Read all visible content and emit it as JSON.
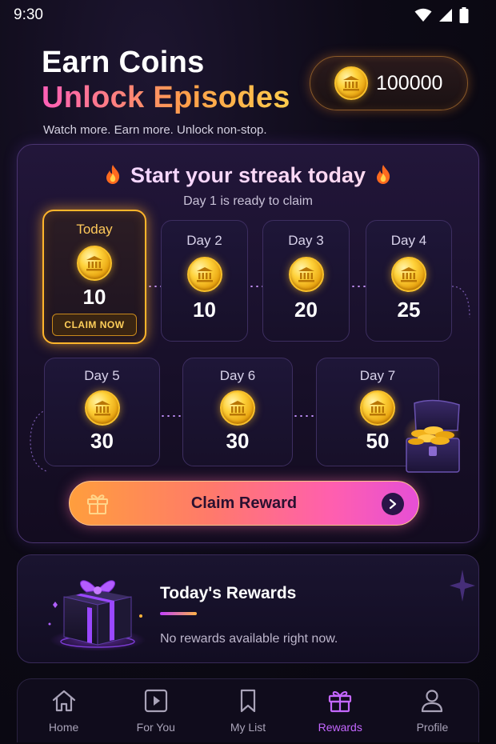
{
  "status_bar": {
    "time": "9:30"
  },
  "header": {
    "title_line1": "Earn Coins",
    "title_line2": "Unlock Episodes",
    "subtitle": "Watch more. Earn more. Unlock non-stop."
  },
  "coin_balance": {
    "value": "100000"
  },
  "streak": {
    "title": "Start your streak today",
    "subtitle": "Day 1 is ready to claim",
    "days": [
      {
        "label": "Today",
        "amount": "10",
        "action": "CLAIM NOW"
      },
      {
        "label": "Day 2",
        "amount": "10"
      },
      {
        "label": "Day 3",
        "amount": "20"
      },
      {
        "label": "Day 4",
        "amount": "25"
      },
      {
        "label": "Day 5",
        "amount": "30"
      },
      {
        "label": "Day 6",
        "amount": "30"
      },
      {
        "label": "Day 7",
        "amount": "50"
      }
    ],
    "claim_button": "Claim Reward"
  },
  "rewards": {
    "title": "Today's Rewards",
    "empty_text": "No rewards available right now."
  },
  "nav": {
    "items": [
      {
        "label": "Home",
        "icon": "home-icon"
      },
      {
        "label": "For You",
        "icon": "play-icon"
      },
      {
        "label": "My List",
        "icon": "bookmark-icon"
      },
      {
        "label": "Rewards",
        "icon": "gift-icon",
        "active": true
      },
      {
        "label": "Profile",
        "icon": "profile-icon"
      }
    ]
  },
  "colors": {
    "accent_purple": "#c467ff",
    "gold": "#ffb52b",
    "claim_gradient_start": "#ff9e3d",
    "claim_gradient_end": "#e64fd6"
  }
}
